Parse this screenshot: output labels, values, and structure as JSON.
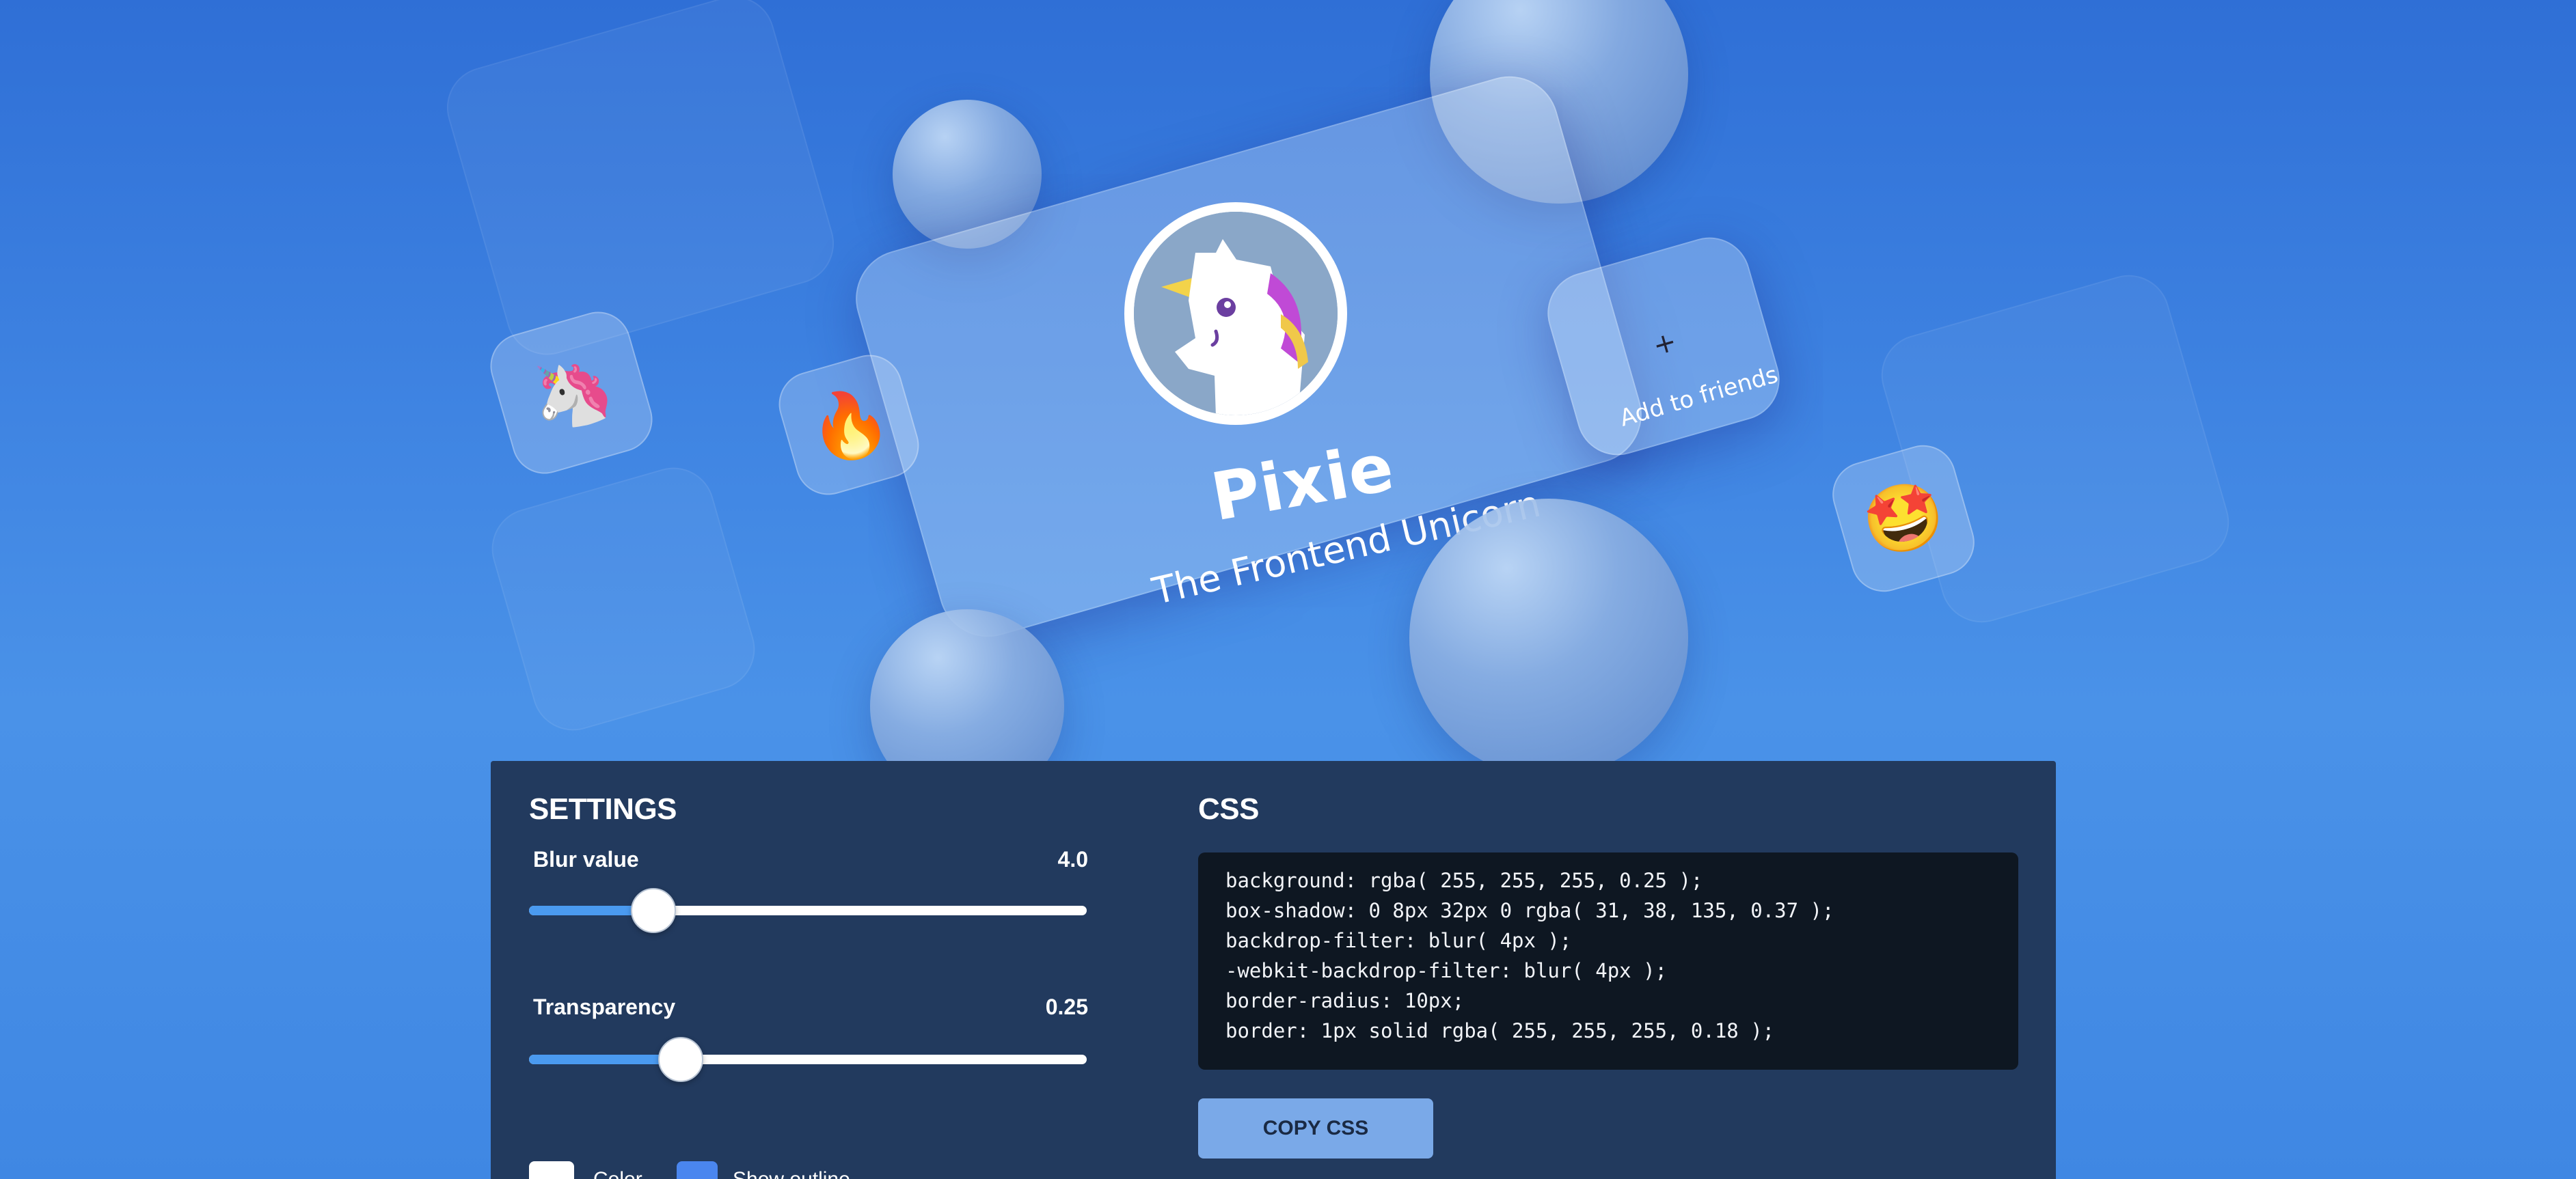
{
  "profile": {
    "name": "Pixie",
    "subtitle": "The Frontend Unicorn",
    "add_friend_label": "Add to friends",
    "add_friend_icon": "+"
  },
  "emoji_tiles": {
    "unicorn": "🦄",
    "fire": "🔥",
    "star_struck": "🤩"
  },
  "settings": {
    "title": "SETTINGS",
    "blur": {
      "label": "Blur value",
      "value": "4.0",
      "fraction": 0.22
    },
    "transparency": {
      "label": "Transparency",
      "value": "0.25",
      "fraction": 0.27
    },
    "checkbox_one": {
      "label": "Color",
      "checked": false
    },
    "checkbox_two": {
      "label": "Show outline",
      "checked": true
    }
  },
  "css_panel": {
    "title": "CSS",
    "lines": [
      "background: rgba( 255, 255, 255, 0.25 );",
      "box-shadow: 0 8px 32px 0 rgba( 31, 38, 135, 0.37 );",
      "backdrop-filter: blur( 4px );",
      "-webkit-backdrop-filter: blur( 4px );",
      "border-radius: 10px;",
      "border: 1px solid rgba( 255, 255, 255, 0.18 );"
    ],
    "copy_label": "COPY CSS"
  },
  "colors": {
    "panel_bg": "#223a5e",
    "slider_fill": "#4a9af0",
    "button_bg": "#7aa9e8",
    "code_bg": "#0e1722"
  }
}
